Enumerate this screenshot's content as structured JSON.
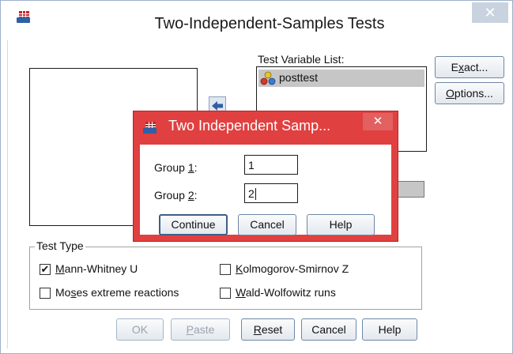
{
  "main_dialog": {
    "title": "Two-Independent-Samples Tests",
    "close_glyph": "✕",
    "test_variable_list": {
      "label": "Test Variable List:",
      "items": [
        {
          "label": "posttest",
          "icon": "scale-variable-icon"
        }
      ]
    },
    "buttons": {
      "exact": "Exact...",
      "options": "Options...",
      "ok": "OK",
      "paste": "Paste",
      "reset": "Reset",
      "cancel": "Cancel",
      "help": "Help"
    },
    "test_type": {
      "label": "Test Type",
      "options": [
        {
          "label": "Mann-Whitney U",
          "checked": true
        },
        {
          "label": "Kolmogorov-Smirnov Z",
          "checked": false
        },
        {
          "label": "Moses extreme reactions",
          "checked": false
        },
        {
          "label": "Wald-Wolfowitz runs",
          "checked": false
        }
      ]
    }
  },
  "sub_dialog": {
    "title": "Two Independent Samp...",
    "close_glyph": "✕",
    "group1": {
      "label": "Group 1:",
      "value": "1"
    },
    "group2": {
      "label": "Group 2:",
      "value": "2"
    },
    "buttons": {
      "continue": "Continue",
      "cancel": "Cancel",
      "help": "Help"
    }
  },
  "colors": {
    "subdialog_frame": "#e04040",
    "move_arrow": "#2f5fa7",
    "list_selection": "#c6c6c6"
  }
}
